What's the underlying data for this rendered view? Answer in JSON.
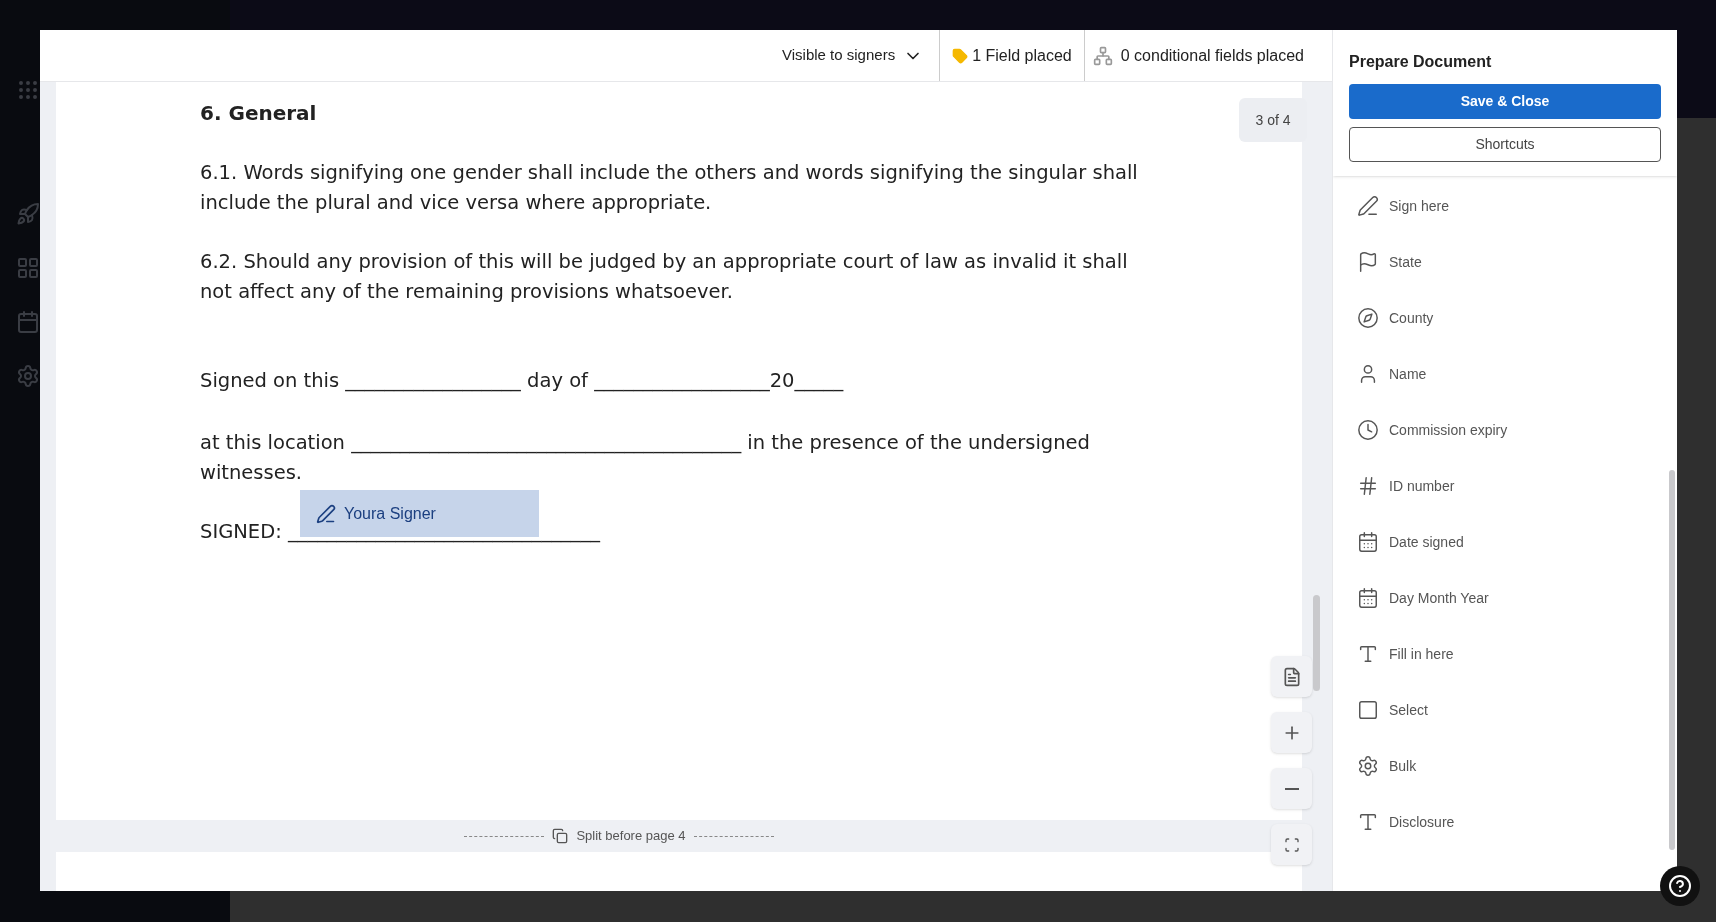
{
  "toolbar": {
    "visibility": "Visible to signers",
    "fields_placed": "1 Field placed",
    "conditional": "0 conditional fields placed"
  },
  "document": {
    "page_indicator": "3 of 4",
    "heading": "6. General",
    "paragraphs": [
      "6.1. Words signifying one gender shall include the others and words signifying the singular shall include the plural and vice versa where appropriate.",
      "6.2. Should any provision of this will be judged by an appropriate court of law as invalid it shall not affect any of the remaining provisions whatsoever."
    ],
    "signed_line": "Signed on this __________________ day of __________________20_____",
    "location_line": "at this location ________________________________________ in the presence of the undersigned witnesses.",
    "signed_label": "SIGNED: ________________________________",
    "signature_field": {
      "signer": "Youra Signer"
    },
    "split_label": "Split before page 4"
  },
  "panel": {
    "title": "Prepare Document",
    "buttons": [
      {
        "label": "Save & Close",
        "kind": "primary"
      },
      {
        "label": "Shortcuts",
        "kind": "secondary"
      }
    ],
    "fields": [
      {
        "label": "Sign here",
        "kind": "pen"
      },
      {
        "label": "State",
        "kind": "flag"
      },
      {
        "label": "County",
        "kind": "compass"
      },
      {
        "label": "Name",
        "kind": "person"
      },
      {
        "label": "Commission expiry",
        "kind": "clock"
      },
      {
        "label": "ID number",
        "kind": "hash"
      },
      {
        "label": "Date signed",
        "kind": "calendar"
      },
      {
        "label": "Day Month Year",
        "kind": "calendar"
      },
      {
        "label": "Fill in here",
        "kind": "text"
      },
      {
        "label": "Select",
        "kind": "checkbox"
      },
      {
        "label": "Bulk",
        "kind": "gear"
      },
      {
        "label": "Disclosure",
        "kind": "text"
      }
    ]
  }
}
